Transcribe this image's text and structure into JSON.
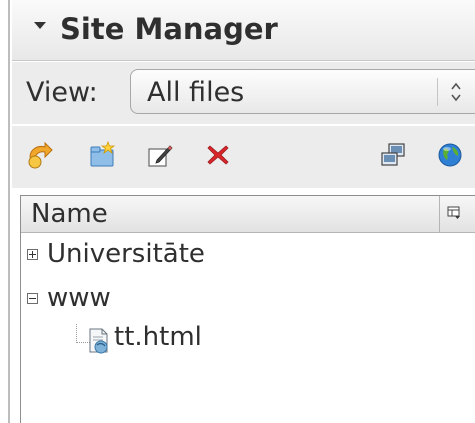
{
  "panel": {
    "title": "Site Manager",
    "collapse_icon": "chevron-down-icon"
  },
  "view": {
    "label": "View:",
    "selected": "All files"
  },
  "toolbar": {
    "icons": [
      "connect-icon",
      "new-folder-icon",
      "edit-icon",
      "delete-icon",
      "sync-icon",
      "publish-globe-icon"
    ]
  },
  "tree": {
    "column_header": "Name",
    "items": [
      {
        "label": "Universitāte",
        "expanded": false
      },
      {
        "label": "www",
        "expanded": true,
        "children": [
          {
            "label": "tt.html"
          }
        ]
      }
    ]
  },
  "colors": {
    "delete_red": "#d9262b",
    "folder_yellow": "#f2c13a",
    "globe_blue": "#2f80d5",
    "globe_green": "#5bb032"
  }
}
